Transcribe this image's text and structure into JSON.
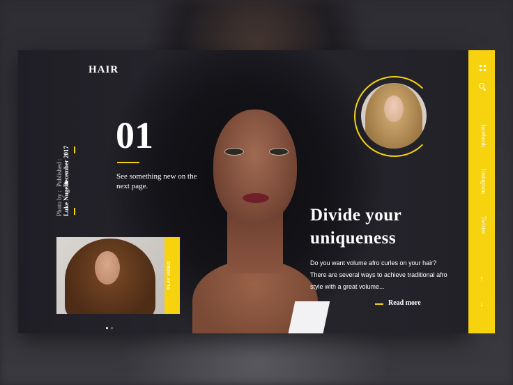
{
  "brand": {
    "logo": "HAIR"
  },
  "meta": {
    "published_label": "Published :",
    "published_date": "December 2017",
    "photo_label": "Photo by :",
    "photo_author": "Luke Nugent"
  },
  "slide": {
    "number": "01",
    "subtitle": "See something new on the next page.",
    "headline_line1": "Divide your",
    "headline_line2": "uniqueness",
    "description": "Do you want volume afro curles on your hair? There are several ways to achieve traditional afro style with a great volume...",
    "read_more": "Read more"
  },
  "thumbnail": {
    "play_label": "PLAY VIDEO",
    "dots": 2,
    "active_dot": 0
  },
  "sidebar": {
    "social": [
      "facebook",
      "Instagram",
      "Twitter"
    ],
    "icons": [
      "grid-icon",
      "search-icon",
      "arrow-up-icon",
      "arrow-down-icon"
    ],
    "arrow_up": "↑",
    "arrow_down": "↓"
  },
  "colors": {
    "accent": "#f6d20f",
    "card_bg": "#1f1e25",
    "text": "#ffffff"
  }
}
